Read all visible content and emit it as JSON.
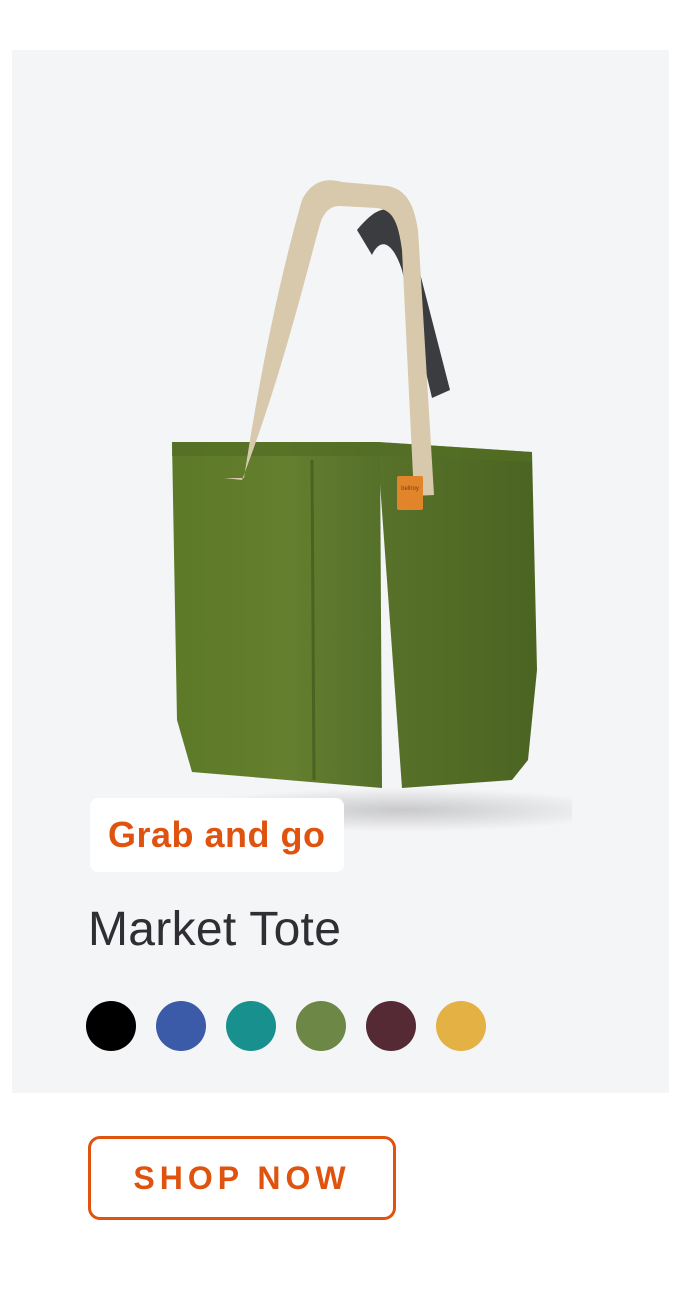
{
  "product": {
    "badge": "Grab and go",
    "name": "Market Tote",
    "image_icon": "tote-bag-product-image",
    "logo_tag": "bellroy",
    "swatches": [
      {
        "name": "black",
        "color": "#000000"
      },
      {
        "name": "blue",
        "color": "#3b5aa8"
      },
      {
        "name": "teal",
        "color": "#17908e"
      },
      {
        "name": "olive",
        "color": "#6d8746"
      },
      {
        "name": "maroon",
        "color": "#562a35"
      },
      {
        "name": "mustard",
        "color": "#e4b244"
      }
    ]
  },
  "cta": {
    "label": "SHOP NOW"
  },
  "colors": {
    "accent": "#e0530f",
    "card_background": "#f4f5f7",
    "bag_green": "#5f7a2a",
    "strap_beige": "#d8c9ac"
  }
}
